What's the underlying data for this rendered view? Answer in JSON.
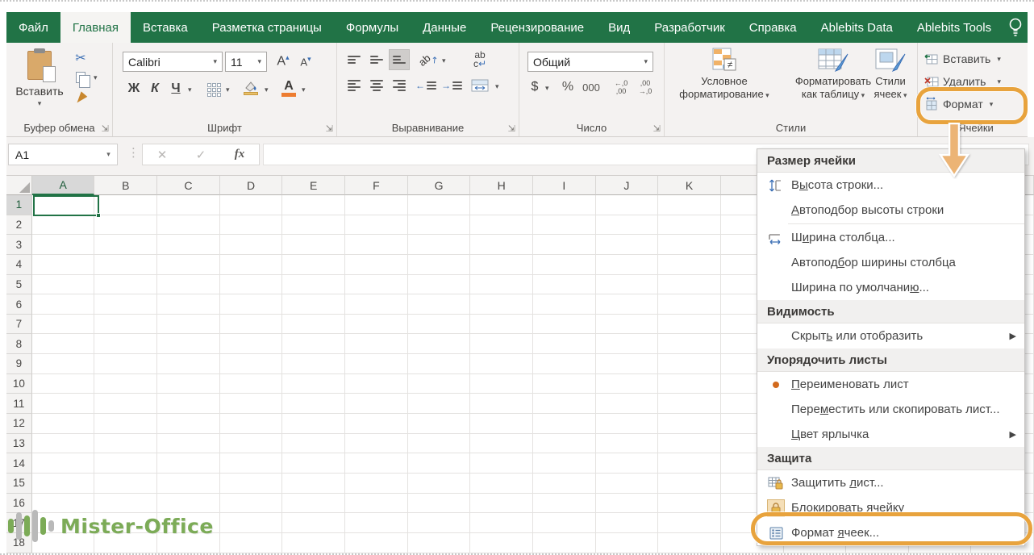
{
  "accent": {
    "excel_green": "#217346",
    "annotation_orange": "#e8a33d",
    "arrow_fill": "#ecb475"
  },
  "tabs": {
    "active_index": 1,
    "items": [
      "Файл",
      "Главная",
      "Вставка",
      "Разметка страницы",
      "Формулы",
      "Данные",
      "Рецензирование",
      "Вид",
      "Разработчик",
      "Справка",
      "Ablebits Data",
      "Ablebits Tools"
    ]
  },
  "ribbon": {
    "clipboard": {
      "paste_label": "Вставить",
      "group_label": "Буфер обмена"
    },
    "font": {
      "family": "Calibri",
      "size": "11",
      "bold": "Ж",
      "italic": "К",
      "underline": "Ч",
      "group_label": "Шрифт"
    },
    "alignment": {
      "wrap_top": "ab",
      "wrap_bottom": "c",
      "orient_text": "ab",
      "group_label": "Выравнивание"
    },
    "number": {
      "format": "Общий",
      "currency": "$",
      "percent": "%",
      "thousands": "000",
      "inc_dec_top": "←,0",
      "inc_dec_bottom": ",00",
      "dec_dec_top": ",00",
      "dec_dec_bottom": "→,0",
      "group_label": "Число"
    },
    "styles": {
      "conditional_line1": "Условное",
      "conditional_line2": "форматирование",
      "table_line1": "Форматировать",
      "table_line2": "как таблицу",
      "cellstyles_line1": "Стили",
      "cellstyles_line2": "ячеек",
      "neq_badge": "≠",
      "group_label": "Стили"
    },
    "cells": {
      "insert_label": "Вставить",
      "delete_label": "Удалить",
      "format_label": "Формат",
      "group_label": "Ячейки"
    }
  },
  "formula_bar": {
    "name_box": "A1",
    "cancel": "✕",
    "enter": "✓",
    "fx": "fx"
  },
  "sheet": {
    "columns": [
      "A",
      "B",
      "C",
      "D",
      "E",
      "F",
      "G",
      "H",
      "I",
      "J",
      "K"
    ],
    "rows": [
      "1",
      "2",
      "3",
      "4",
      "5",
      "6",
      "7",
      "8",
      "9",
      "10",
      "11",
      "12",
      "13",
      "14",
      "15",
      "16",
      "17",
      "18"
    ],
    "selected_cell": "A1",
    "extra_blank_columns": 5
  },
  "format_menu": {
    "sections": [
      {
        "header": "Размер ячейки",
        "items": [
          {
            "label": "В[ы]сота строки...",
            "icon": "row-height-icon"
          },
          {
            "label": "[А]втоподбор высоты строки",
            "divider_after": true
          },
          {
            "label": "Ш[и]рина столбца...",
            "icon": "col-width-icon"
          },
          {
            "label": "Автопод[б]ор ширины столбца"
          },
          {
            "label": "Ширина по умолчани[ю]..."
          }
        ]
      },
      {
        "header": "Видимость",
        "items": [
          {
            "label": "Скрыт[ь] или отобразить",
            "submenu": true
          }
        ]
      },
      {
        "header": "Упорядочить листы",
        "items": [
          {
            "label": "[П]ереименовать лист",
            "icon": "rename-sheet-icon"
          },
          {
            "label": "Пере[м]естить или скопировать лист..."
          },
          {
            "label": "[Ц]вет ярлычка",
            "submenu": true
          }
        ]
      },
      {
        "header": "Защита",
        "items": [
          {
            "label": "Защитить [л]ист...",
            "icon": "protect-sheet-icon"
          },
          {
            "label": "[Б]локировать ячейку",
            "icon": "lock-cell-icon"
          },
          {
            "label": "Формат [я]чеек...",
            "icon": "format-cells-icon",
            "highlighted": true
          }
        ]
      }
    ]
  },
  "watermark": {
    "text": "Mister-Office"
  }
}
